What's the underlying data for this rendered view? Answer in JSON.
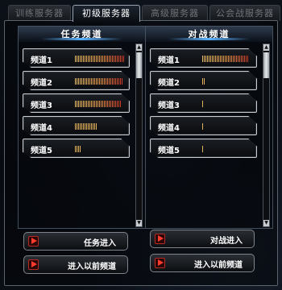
{
  "tabs": [
    {
      "label": "训练服务器",
      "active": false
    },
    {
      "label": "初级服务器",
      "active": true
    },
    {
      "label": "高级服务器",
      "active": false
    },
    {
      "label": "公会战服务器",
      "active": false
    }
  ],
  "left_panel": {
    "title": "任务频道",
    "channels": [
      {
        "label": "频道1",
        "load": 0.98,
        "hot": true
      },
      {
        "label": "频道2",
        "load": 0.95,
        "hot": true
      },
      {
        "label": "频道3",
        "load": 0.92,
        "hot": true
      },
      {
        "label": "频道4",
        "load": 0.45,
        "hot": false
      },
      {
        "label": "频道5",
        "load": 0.12,
        "hot": false
      }
    ],
    "buttons": {
      "enter": "任务进入",
      "rejoin": "进入以前频道"
    }
  },
  "right_panel": {
    "title": "对战频道",
    "channels": [
      {
        "label": "频道1",
        "load": 0.93,
        "hot": true
      },
      {
        "label": "频道2",
        "load": 0.06,
        "hot": false
      },
      {
        "label": "频道3",
        "load": 0.02,
        "hot": false
      },
      {
        "label": "频道4",
        "load": 0.02,
        "hot": false
      },
      {
        "label": "频道5",
        "load": 0.02,
        "hot": false
      }
    ],
    "buttons": {
      "enter": "对战进入",
      "rejoin": "进入以前频道"
    }
  },
  "colors": {
    "accent": "#5cb3ff",
    "bar_low": "#e1b25a",
    "bar_high": "#cc3a2a",
    "button_arrow": "#ff3b2c"
  },
  "icons": {
    "scroll_up": "triangle-up-icon",
    "scroll_down": "triangle-down-icon",
    "button": "red-play-icon"
  }
}
